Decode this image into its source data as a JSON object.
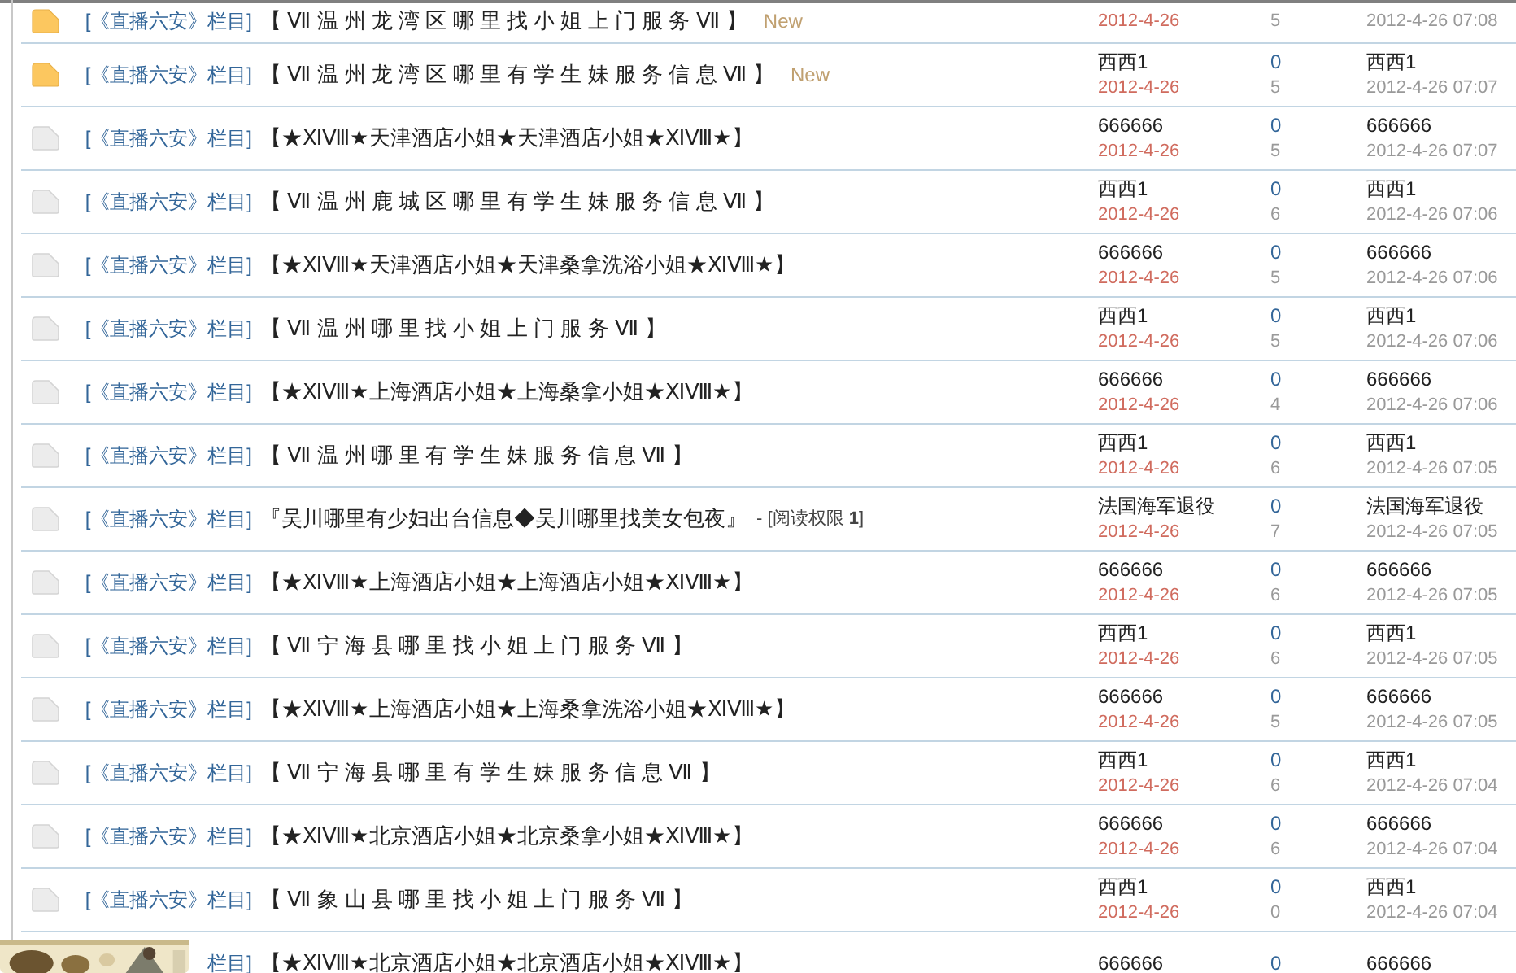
{
  "threads": [
    {
      "category": "[《直播六安》栏目]",
      "title": "【 Ⅶ 温 州 龙 湾 区 哪 里 找 小 姐 上 门 服 务 Ⅶ 】",
      "new": true,
      "new_label": "New",
      "date": "2012-4-26",
      "views": "5",
      "last_time": "2012-4-26 07:08"
    },
    {
      "category": "[《直播六安》栏目]",
      "title": "【 Ⅶ 温 州 龙 湾 区 哪 里 有 学 生 妹 服 务 信 息 Ⅶ 】",
      "new": true,
      "new_label": "New",
      "author": "西西1",
      "date": "2012-4-26",
      "replies": "0",
      "views": "5",
      "last_poster": "西西1",
      "last_time": "2012-4-26 07:07"
    },
    {
      "category": "[《直播六安》栏目]",
      "title": "【★ⅪⅧ★天津酒店小姐★天津酒店小姐★ⅪⅧ★】",
      "new": false,
      "author": "666666",
      "date": "2012-4-26",
      "replies": "0",
      "views": "5",
      "last_poster": "666666",
      "last_time": "2012-4-26 07:07"
    },
    {
      "category": "[《直播六安》栏目]",
      "title": "【 Ⅶ 温 州 鹿 城 区 哪 里 有 学 生 妹 服 务 信 息 Ⅶ 】",
      "new": false,
      "author": "西西1",
      "date": "2012-4-26",
      "replies": "0",
      "views": "6",
      "last_poster": "西西1",
      "last_time": "2012-4-26 07:06"
    },
    {
      "category": "[《直播六安》栏目]",
      "title": "【★ⅪⅧ★天津酒店小姐★天津桑拿洗浴小姐★ⅪⅧ★】",
      "new": false,
      "author": "666666",
      "date": "2012-4-26",
      "replies": "0",
      "views": "5",
      "last_poster": "666666",
      "last_time": "2012-4-26 07:06"
    },
    {
      "category": "[《直播六安》栏目]",
      "title": "【 Ⅶ 温 州 哪 里 找 小 姐 上 门 服 务 Ⅶ 】",
      "new": false,
      "author": "西西1",
      "date": "2012-4-26",
      "replies": "0",
      "views": "5",
      "last_poster": "西西1",
      "last_time": "2012-4-26 07:06"
    },
    {
      "category": "[《直播六安》栏目]",
      "title": "【★ⅪⅧ★上海酒店小姐★上海桑拿小姐★ⅪⅧ★】",
      "new": false,
      "author": "666666",
      "date": "2012-4-26",
      "replies": "0",
      "views": "4",
      "last_poster": "666666",
      "last_time": "2012-4-26 07:06"
    },
    {
      "category": "[《直播六安》栏目]",
      "title": "【 Ⅶ 温 州 哪 里 有 学 生 妹 服 务 信 息 Ⅶ 】",
      "new": false,
      "author": "西西1",
      "date": "2012-4-26",
      "replies": "0",
      "views": "6",
      "last_poster": "西西1",
      "last_time": "2012-4-26 07:05"
    },
    {
      "category": "[《直播六安》栏目]",
      "title": "『吴川哪里有少妇出台信息◆吴川哪里找美女包夜』",
      "permission": "- [阅读权限 **1**]",
      "new": false,
      "author": "法国海军退役",
      "date": "2012-4-26",
      "replies": "0",
      "views": "7",
      "last_poster": "法国海军退役",
      "last_time": "2012-4-26 07:05"
    },
    {
      "category": "[《直播六安》栏目]",
      "title": "【★ⅪⅧ★上海酒店小姐★上海酒店小姐★ⅪⅧ★】",
      "new": false,
      "author": "666666",
      "date": "2012-4-26",
      "replies": "0",
      "views": "6",
      "last_poster": "666666",
      "last_time": "2012-4-26 07:05"
    },
    {
      "category": "[《直播六安》栏目]",
      "title": "【 Ⅶ 宁 海 县 哪 里 找 小 姐 上 门 服 务 Ⅶ 】",
      "new": false,
      "author": "西西1",
      "date": "2012-4-26",
      "replies": "0",
      "views": "6",
      "last_poster": "西西1",
      "last_time": "2012-4-26 07:05"
    },
    {
      "category": "[《直播六安》栏目]",
      "title": "【★ⅪⅧ★上海酒店小姐★上海桑拿洗浴小姐★ⅪⅧ★】",
      "new": false,
      "author": "666666",
      "date": "2012-4-26",
      "replies": "0",
      "views": "5",
      "last_poster": "666666",
      "last_time": "2012-4-26 07:05"
    },
    {
      "category": "[《直播六安》栏目]",
      "title": "【 Ⅶ 宁 海 县 哪 里 有 学 生 妹 服 务 信 息 Ⅶ 】",
      "new": false,
      "author": "西西1",
      "date": "2012-4-26",
      "replies": "0",
      "views": "6",
      "last_poster": "西西1",
      "last_time": "2012-4-26 07:04"
    },
    {
      "category": "[《直播六安》栏目]",
      "title": "【★ⅪⅧ★北京酒店小姐★北京桑拿小姐★ⅪⅧ★】",
      "new": false,
      "author": "666666",
      "date": "2012-4-26",
      "replies": "0",
      "views": "6",
      "last_poster": "666666",
      "last_time": "2012-4-26 07:04"
    },
    {
      "category": "[《直播六安》栏目]",
      "title": "【 Ⅶ 象 山 县 哪 里 找 小 姐 上 门 服 务 Ⅶ 】",
      "new": false,
      "author": "西西1",
      "date": "2012-4-26",
      "replies": "0",
      "views": "0",
      "last_poster": "西西1",
      "last_time": "2012-4-26 07:04"
    },
    {
      "category": "栏目]",
      "title": "【★ⅪⅧ★北京酒店小姐★北京酒店小姐★ⅪⅧ★】",
      "author": "666666",
      "replies": "0",
      "last_poster": "666666"
    }
  ]
}
